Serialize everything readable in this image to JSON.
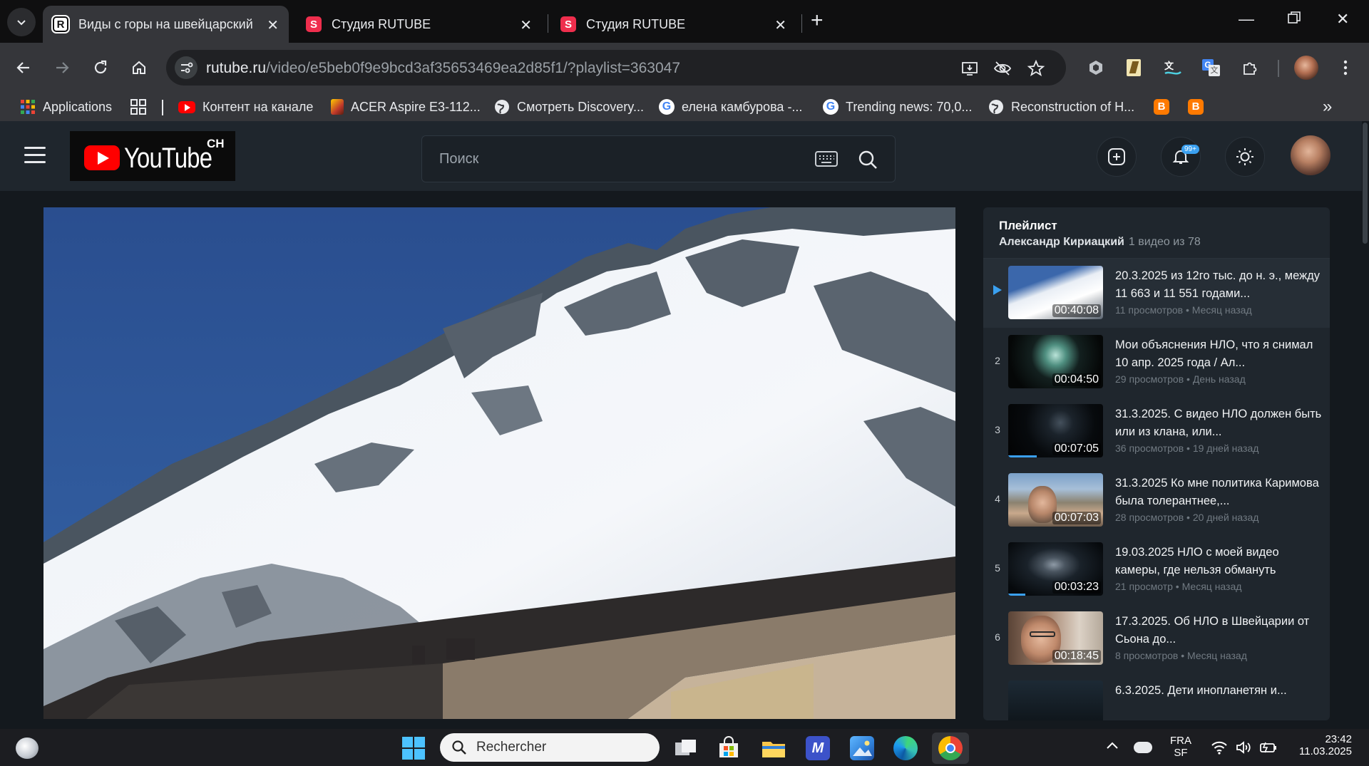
{
  "browser": {
    "tabs": [
      {
        "title": "Виды с горы на швейцарский",
        "favicon": "R",
        "active": true
      },
      {
        "title": "Студия RUTUBE",
        "favicon": "S",
        "active": false
      },
      {
        "title": "Студия RUTUBE",
        "favicon": "S",
        "active": false
      }
    ],
    "url_domain": "rutube.ru",
    "url_path": "/video/e5beb0f9e9bcd3af35653469ea2d85f1/?playlist=363047",
    "bookmarks": [
      {
        "label": "Applications",
        "icon": "apps-grid-icon"
      },
      {
        "label": "",
        "icon": "grid-icon"
      },
      {
        "label": "Контент на канале",
        "icon": "youtube-icon"
      },
      {
        "label": "ACER Aspire E3-112...",
        "icon": "acer-icon"
      },
      {
        "label": "Смотреть Discovery...",
        "icon": "globe-icon"
      },
      {
        "label": "елена камбурова -...",
        "icon": "google-icon"
      },
      {
        "label": "Trending news: 70,0...",
        "icon": "google-icon"
      },
      {
        "label": "Reconstruction of H...",
        "icon": "globe-icon"
      }
    ]
  },
  "site": {
    "logo_text": "YouTube",
    "logo_badge": "CH",
    "search_placeholder": "Поиск",
    "notifications_badge": "99+"
  },
  "playlist": {
    "title": "Плейлист",
    "author": "Александр Кириацкий",
    "count": "1 видео из 78",
    "items": [
      {
        "index": "",
        "title": "20.3.2025 из 12го тыс. до н. э., между 11 663 и 11 551 годами...",
        "duration": "00:40:08",
        "meta": "11 просмотров • Месяц назад",
        "progress": 0,
        "current": true
      },
      {
        "index": "2",
        "title": "Мои объяснения НЛО, что я снимал 10 апр. 2025 года / Ал...",
        "duration": "00:04:50",
        "meta": "29 просмотров • День назад",
        "progress": 0
      },
      {
        "index": "3",
        "title": "31.3.2025. С видео НЛО должен быть или из клана, или...",
        "duration": "00:07:05",
        "meta": "36 просмотров • 19 дней назад",
        "progress": 0.3
      },
      {
        "index": "4",
        "title": "31.3.2025 Ко мне политика Каримова была толерантнее,...",
        "duration": "00:07:03",
        "meta": "28 просмотров • 20 дней назад",
        "progress": 0
      },
      {
        "index": "5",
        "title": "19.03.2025 НЛО с моей видео камеры, где нельзя обмануть",
        "duration": "00:03:23",
        "meta": "21 просмотр • Месяц назад",
        "progress": 0.18
      },
      {
        "index": "6",
        "title": "17.3.2025. Об НЛО в Швейцарии от Сьона до...",
        "duration": "00:18:45",
        "meta": "8 просмотров • Месяц назад",
        "progress": 0
      },
      {
        "index": "",
        "title": "6.3.2025. Дети инопланетян и...",
        "duration": "",
        "meta": "",
        "progress": 0
      }
    ]
  },
  "taskbar": {
    "search_placeholder": "Rechercher",
    "lang": "FRA",
    "lang_sub": "SF",
    "time": "23:42",
    "date": "11.03.2025"
  },
  "colors": {
    "accent": "#3aa0f0",
    "page_bg": "#14191e",
    "header_bg": "#1f262d",
    "rutube_red": "#ef2e4d"
  }
}
